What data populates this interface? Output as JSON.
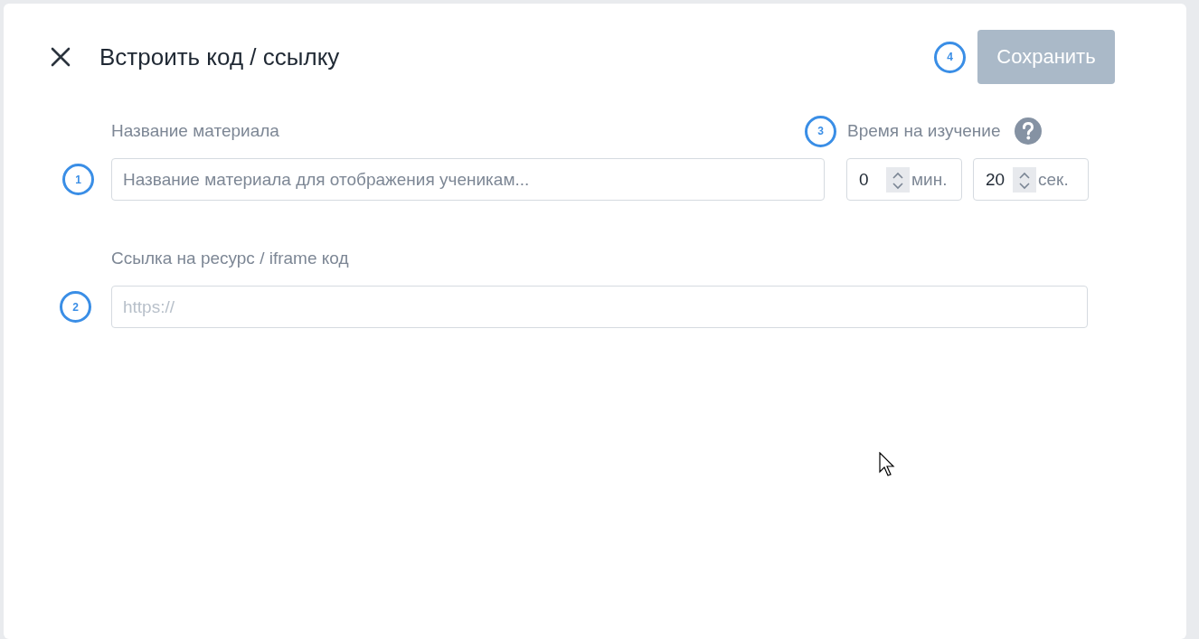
{
  "header": {
    "title": "Встроить код / ссылку",
    "save_button": {
      "label": "Сохранить",
      "disabled": true
    },
    "save_marker": "4"
  },
  "material_name": {
    "label": "Название материала",
    "placeholder": "Название материала для отображения ученикам...",
    "marker": "1"
  },
  "study_time": {
    "label": "Время на изучение",
    "marker": "3",
    "inputs": [
      {
        "value": "0",
        "unit": "мин."
      },
      {
        "value": "20",
        "unit": "сек."
      }
    ]
  },
  "resource_link": {
    "label": "Ссылка на ресурс / iframe код",
    "placeholder": "https://",
    "marker": "2"
  }
}
